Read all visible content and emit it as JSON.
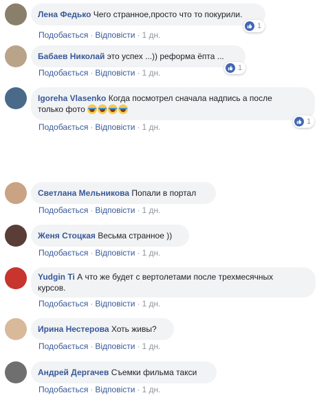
{
  "actions": {
    "like": "Подобається",
    "reply": "Відповісти",
    "separator": "·"
  },
  "comments": [
    {
      "author": "Лена Федько",
      "text": "Чего странное,просто что то покурили.",
      "time": "1 дн.",
      "likes": "1",
      "avatar_color": "#8a7f6b"
    },
    {
      "author": "Бабаев Николай",
      "text": "это успех ...)) реформа ёпта ...",
      "time": "1 дн.",
      "likes": "1",
      "avatar_color": "#b9a48a"
    },
    {
      "author": "Igoreha Vlasenko",
      "text_line1": "Когда посмотрел сначала надпись а после",
      "text_line2": "только фото",
      "emoji_count": 4,
      "time": "1 дн.",
      "likes": "1",
      "avatar_color": "#4a6a8a"
    },
    {
      "author": "Светлана Мельникова",
      "text": "Попали в портал",
      "time": "1 дн.",
      "avatar_color": "#c9a383"
    },
    {
      "author": "Женя Стоцкая",
      "text": "Весьма странное ))",
      "time": "1 дн.",
      "avatar_color": "#5a3d36"
    },
    {
      "author": "Yudgin Ti",
      "text_line1": "А что же будет с вертолетами после трехмесячных",
      "text_line2": "курсов.",
      "time": "1 дн.",
      "avatar_color": "#c7352e"
    },
    {
      "author": "Ирина Нестерова",
      "text": "Хоть живы?",
      "time": "1 дн.",
      "avatar_color": "#d8b99a"
    },
    {
      "author": "Андрей Дергачев",
      "text": "Съемки фильма такси",
      "time": "1 дн.",
      "avatar_color": "#6f6f6f"
    }
  ]
}
